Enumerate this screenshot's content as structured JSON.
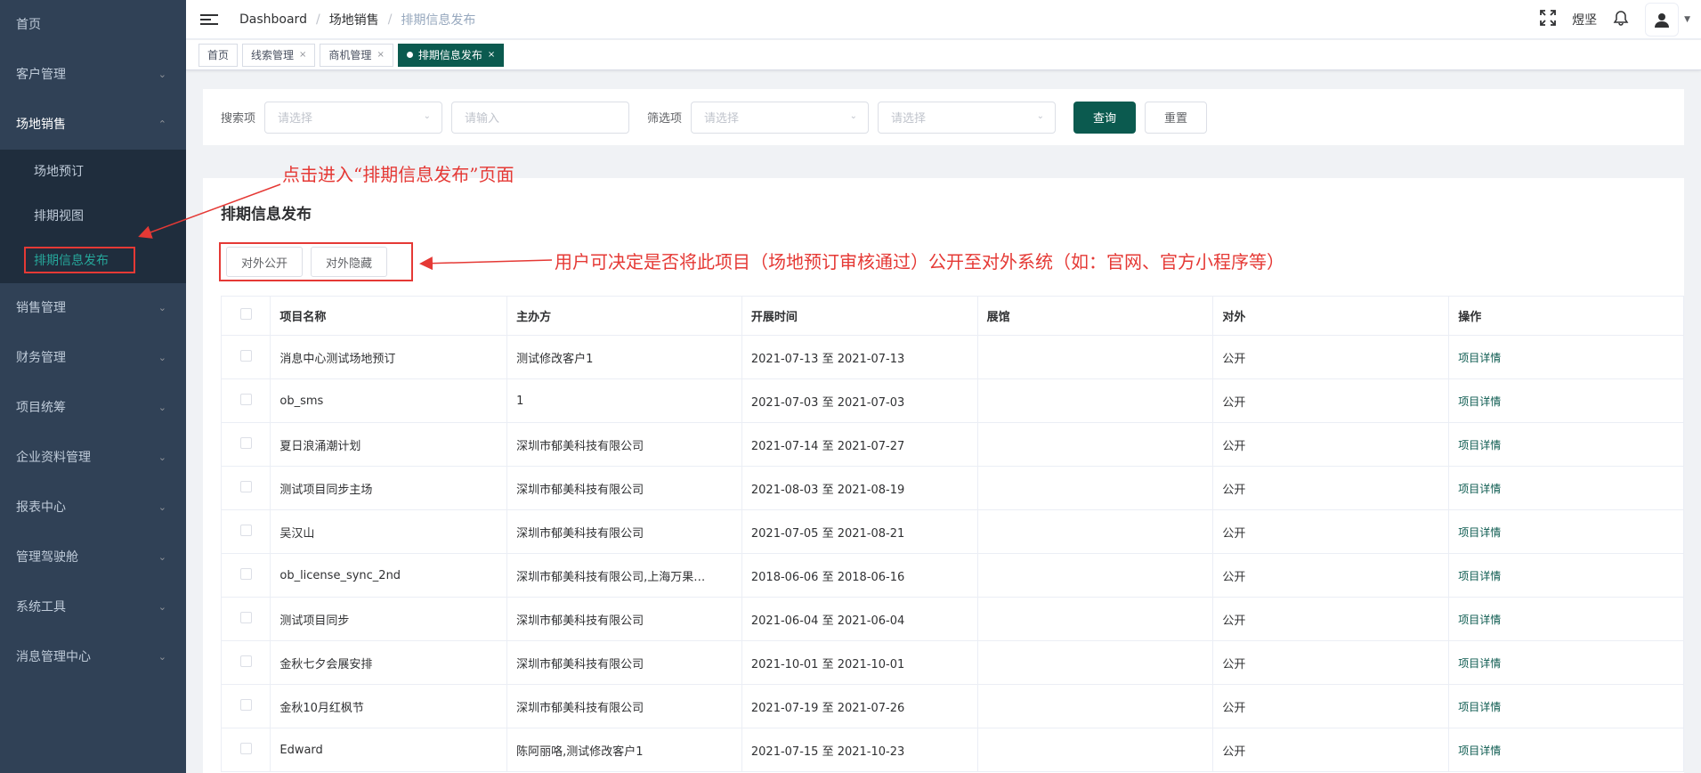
{
  "sidebar": {
    "items": [
      {
        "label": "首页",
        "has_arrow": false
      },
      {
        "label": "客户管理",
        "has_arrow": true
      },
      {
        "label": "场地销售",
        "has_arrow": true,
        "open": true
      },
      {
        "label": "销售管理",
        "has_arrow": true
      },
      {
        "label": "财务管理",
        "has_arrow": true
      },
      {
        "label": "项目统筹",
        "has_arrow": true
      },
      {
        "label": "企业资料管理",
        "has_arrow": true
      },
      {
        "label": "报表中心",
        "has_arrow": true
      },
      {
        "label": "管理驾驶舱",
        "has_arrow": true
      },
      {
        "label": "系统工具",
        "has_arrow": true
      },
      {
        "label": "消息管理中心",
        "has_arrow": true
      }
    ],
    "submenu": [
      {
        "label": "场地预订"
      },
      {
        "label": "排期视图"
      },
      {
        "label": "排期信息发布",
        "active": true
      }
    ]
  },
  "header": {
    "breadcrumb": [
      "Dashboard",
      "场地销售",
      "排期信息发布"
    ],
    "user_name": "煜坚"
  },
  "tags": [
    {
      "label": "首页",
      "closable": false
    },
    {
      "label": "线索管理",
      "closable": true
    },
    {
      "label": "商机管理",
      "closable": true
    },
    {
      "label": "排期信息发布",
      "closable": true,
      "active": true
    }
  ],
  "search": {
    "search_label": "搜索项",
    "select1_placeholder": "请选择",
    "input_placeholder": "请输入",
    "filter_label": "筛选项",
    "select2_placeholder": "请选择",
    "select3_placeholder": "请选择",
    "query_button": "查询",
    "reset_button": "重置"
  },
  "main": {
    "title": "排期信息发布",
    "public_button": "对外公开",
    "hide_button": "对外隐藏"
  },
  "table": {
    "columns": [
      "项目名称",
      "主办方",
      "开展时间",
      "展馆",
      "对外",
      "操作"
    ],
    "rows": [
      {
        "name": "消息中心测试场地预订",
        "organizer": "测试修改客户1",
        "time": "2021-07-13 至 2021-07-13",
        "hall": "",
        "visibility": "公开",
        "action": "项目详情"
      },
      {
        "name": "ob_sms",
        "organizer": "1",
        "time": "2021-07-03 至 2021-07-03",
        "hall": "",
        "visibility": "公开",
        "action": "项目详情"
      },
      {
        "name": "夏日浪涌潮计划",
        "organizer": "深圳市郁美科技有限公司",
        "time": "2021-07-14 至 2021-07-27",
        "hall": "",
        "visibility": "公开",
        "action": "项目详情"
      },
      {
        "name": "测试项目同步主场",
        "organizer": "深圳市郁美科技有限公司",
        "time": "2021-08-03 至 2021-08-19",
        "hall": "",
        "visibility": "公开",
        "action": "项目详情"
      },
      {
        "name": "吴汉山",
        "organizer": "深圳市郁美科技有限公司",
        "time": "2021-07-05 至 2021-08-21",
        "hall": "",
        "visibility": "公开",
        "action": "项目详情"
      },
      {
        "name": "ob_license_sync_2nd",
        "organizer": "深圳市郁美科技有限公司,上海万果…",
        "time": "2018-06-06 至 2018-06-16",
        "hall": "",
        "visibility": "公开",
        "action": "项目详情"
      },
      {
        "name": "测试项目同步",
        "organizer": "深圳市郁美科技有限公司",
        "time": "2021-06-04 至 2021-06-04",
        "hall": "",
        "visibility": "公开",
        "action": "项目详情"
      },
      {
        "name": "金秋七夕会展安排",
        "organizer": "深圳市郁美科技有限公司",
        "time": "2021-10-01 至 2021-10-01",
        "hall": "",
        "visibility": "公开",
        "action": "项目详情"
      },
      {
        "name": "金秋10月红枫节",
        "organizer": "深圳市郁美科技有限公司",
        "time": "2021-07-19 至 2021-07-26",
        "hall": "",
        "visibility": "公开",
        "action": "项目详情"
      },
      {
        "name": "Edward",
        "organizer": "陈阿丽咯,测试修改客户1",
        "time": "2021-07-15 至 2021-10-23",
        "hall": "",
        "visibility": "公开",
        "action": "项目详情"
      }
    ]
  },
  "annotations": {
    "sidebar_note": "点击进入“排期信息发布”页面",
    "toggle_note": "用户可决定是否将此项目（场地预订审核通过）公开至对外系统（如：官网、官方小程序等）",
    "color": "#e53935"
  },
  "colors": {
    "sidebar_bg": "#304156",
    "submenu_bg": "#1f2d3d",
    "accent": "#0b5a4f",
    "active_text": "#26a69a"
  }
}
